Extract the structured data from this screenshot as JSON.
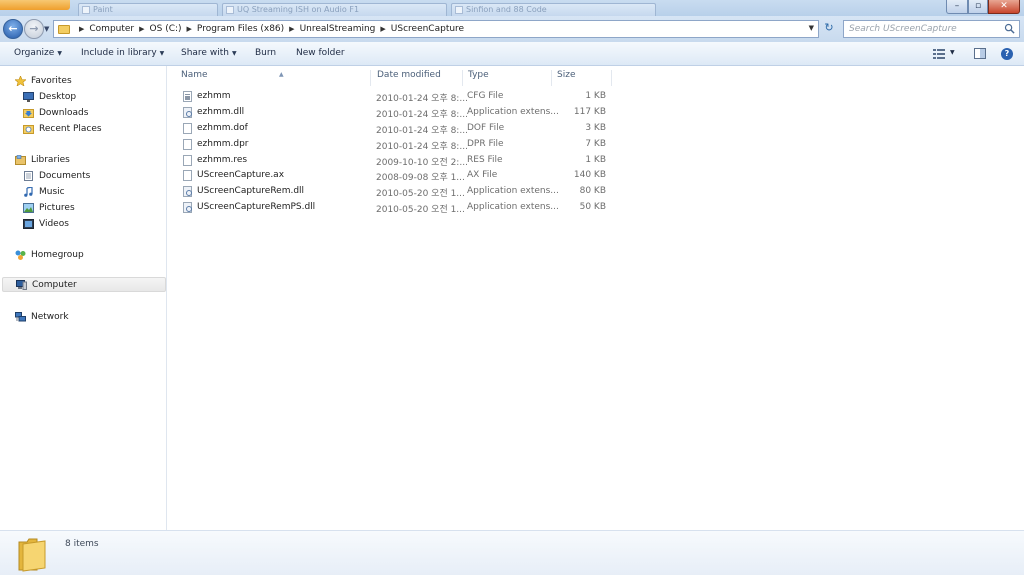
{
  "titlebar": {
    "tabs": [
      "Paint",
      "UQ Streaming ISH on Audio F1",
      "Sinfion and 88 Code"
    ],
    "minimize": "–",
    "maximize": "▫",
    "close": "✕"
  },
  "address": {
    "breadcrumbs": [
      "Computer",
      "OS (C:)",
      "Program Files (x86)",
      "UnrealStreaming",
      "UScreenCapture"
    ],
    "search_placeholder": "Search UScreenCapture"
  },
  "toolbar": {
    "organize": "Organize",
    "include_in_library": "Include in library",
    "share_with": "Share with",
    "burn": "Burn",
    "new_folder": "New folder"
  },
  "nav": {
    "favorites": "Favorites",
    "desktop": "Desktop",
    "downloads": "Downloads",
    "recent_places": "Recent Places",
    "libraries": "Libraries",
    "documents": "Documents",
    "music": "Music",
    "pictures": "Pictures",
    "videos": "Videos",
    "homegroup": "Homegroup",
    "computer": "Computer",
    "network": "Network"
  },
  "columns": {
    "name": "Name",
    "date": "Date modified",
    "type": "Type",
    "size": "Size"
  },
  "files": [
    {
      "name": "ezhmm",
      "date": "2010-01-24 오후 8:...",
      "type": "CFG File",
      "size": "1 KB",
      "icon": "cfg"
    },
    {
      "name": "ezhmm.dll",
      "date": "2010-01-24 오후 8:...",
      "type": "Application extens...",
      "size": "117 KB",
      "icon": "dll"
    },
    {
      "name": "ezhmm.dof",
      "date": "2010-01-24 오후 8:...",
      "type": "DOF File",
      "size": "3 KB",
      "icon": "file"
    },
    {
      "name": "ezhmm.dpr",
      "date": "2010-01-24 오후 8:...",
      "type": "DPR File",
      "size": "7 KB",
      "icon": "file"
    },
    {
      "name": "ezhmm.res",
      "date": "2009-10-10 오전 2:...",
      "type": "RES File",
      "size": "1 KB",
      "icon": "file"
    },
    {
      "name": "UScreenCapture.ax",
      "date": "2008-09-08 오후 1...",
      "type": "AX File",
      "size": "140 KB",
      "icon": "file"
    },
    {
      "name": "UScreenCaptureRem.dll",
      "date": "2010-05-20 오전 1...",
      "type": "Application extens...",
      "size": "80 KB",
      "icon": "dll"
    },
    {
      "name": "UScreenCaptureRemPS.dll",
      "date": "2010-05-20 오전 1...",
      "type": "Application extens...",
      "size": "50 KB",
      "icon": "dll"
    }
  ],
  "details": {
    "count": "8 items"
  }
}
